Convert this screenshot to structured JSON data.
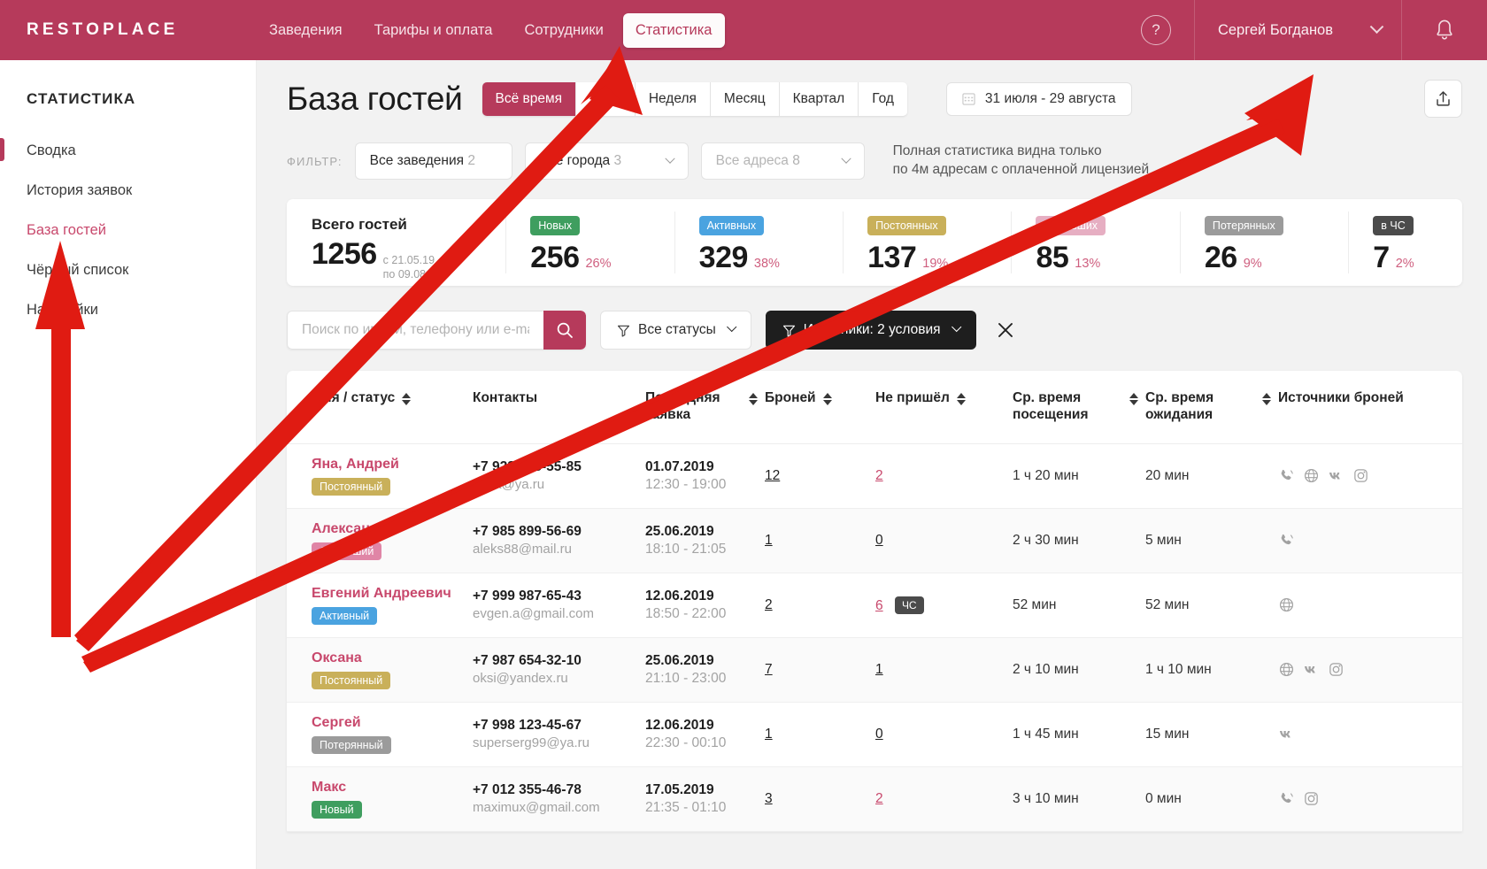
{
  "brand": "RESTOPLACE",
  "topnav": {
    "items": [
      {
        "label": "Заведения",
        "active": false
      },
      {
        "label": "Тарифы и оплата",
        "active": false
      },
      {
        "label": "Сотрудники",
        "active": false
      },
      {
        "label": "Статистика",
        "active": true
      }
    ],
    "help_icon": "question-mark-icon",
    "help_label": "?",
    "user": "Сергей Богданов",
    "bell_icon": "bell-icon"
  },
  "sidebar": {
    "title": "СТАТИСТИКА",
    "items": [
      {
        "label": "Сводка",
        "active": false
      },
      {
        "label": "История заявок",
        "active": false
      },
      {
        "label": "База гостей",
        "active": true
      },
      {
        "label": "Чёрный список",
        "active": false
      },
      {
        "label": "Настройки",
        "active": false
      }
    ]
  },
  "page": {
    "title": "База гостей",
    "periods": [
      {
        "label": "Всё время",
        "active": true
      },
      {
        "label": "День",
        "active": false
      },
      {
        "label": "Неделя",
        "active": false
      },
      {
        "label": "Месяц",
        "active": false
      },
      {
        "label": "Квартал",
        "active": false
      },
      {
        "label": "Год",
        "active": false
      }
    ],
    "daterange": "31 июля - 29 августа",
    "calendar_icon": "calendar-icon",
    "export_icon": "share-export-icon"
  },
  "filters": {
    "label": "ФИЛЬТР:",
    "venues": {
      "text": "Все заведения",
      "count": "2"
    },
    "cities": {
      "text": "Все города",
      "count": "3"
    },
    "addresses": {
      "text": "Все адреса",
      "count": "8"
    },
    "license_note_line1": "Полная статистика видна только",
    "license_note_line2": "по 4м адресам с оплаченной лицензией"
  },
  "stats": {
    "total": {
      "title": "Всего гостей",
      "value": "1256",
      "sub_line1": "с 21.05.19",
      "sub_line2": "по 09.08.19"
    },
    "cards": [
      {
        "badge": "Новых",
        "badge_color": "#3f9e5f",
        "badge_text_color": "#ffffff",
        "value": "256",
        "pct": "26%"
      },
      {
        "badge": "Активных",
        "badge_color": "#4aa3e0",
        "badge_text_color": "#ffffff",
        "value": "329",
        "pct": "38%"
      },
      {
        "badge": "Постоянных",
        "badge_color": "#c9b05a",
        "badge_text_color": "#ffffff",
        "value": "137",
        "pct": "19%"
      },
      {
        "badge": "Остывших",
        "badge_color": "#e6aec2",
        "badge_text_color": "#ffffff",
        "value": "85",
        "pct": "13%"
      },
      {
        "badge": "Потерянных",
        "badge_color": "#9b9b9b",
        "badge_text_color": "#ffffff",
        "value": "26",
        "pct": "9%"
      },
      {
        "badge": "в ЧС",
        "badge_color": "#4b4b4b",
        "badge_text_color": "#ffffff",
        "value": "7",
        "pct": "2%"
      }
    ]
  },
  "search": {
    "placeholder": "Поиск по имени, телефону или e-mail",
    "value": "",
    "search_icon": "search-icon",
    "status_chip": "Все статусы",
    "sources_chip": "Источники: 2 условия",
    "filter_icon": "funnel-icon",
    "clear_icon": "close-x-icon"
  },
  "table": {
    "columns": [
      {
        "label": "Имя / статус",
        "sortable": true
      },
      {
        "label": "Контакты",
        "sortable": false
      },
      {
        "label": "Последняя заявка",
        "sortable": true
      },
      {
        "label": "Броней",
        "sortable": true
      },
      {
        "label": "Не пришёл",
        "sortable": true
      },
      {
        "label": "Ср. время посещения",
        "sortable": true
      },
      {
        "label": "Ср. время ожидания",
        "sortable": true
      },
      {
        "label": "Источники броней",
        "sortable": false
      }
    ],
    "rows": [
      {
        "name": "Яна, Андрей",
        "status": "Постоянный",
        "status_color": "#c9b05a",
        "phone": "+7 928 565-55-85",
        "email": "yana@ya.ru",
        "date": "01.07.2019",
        "time": "12:30 - 19:00",
        "bookings": "12",
        "noshow": "2",
        "noshow_flag": "",
        "avg_visit": "1 ч 20 мин",
        "avg_wait": "20 мин",
        "sources": [
          "phone-icon",
          "globe-icon",
          "vk-icon",
          "instagram-icon"
        ]
      },
      {
        "name": "Александр",
        "status": "Остывший",
        "status_color": "#e085a6",
        "phone": "+7 985 899-56-69",
        "email": "aleks88@mail.ru",
        "date": "25.06.2019",
        "time": "18:10 - 21:05",
        "bookings": "1",
        "noshow": "0",
        "noshow_flag": "",
        "avg_visit": "2 ч 30 мин",
        "avg_wait": "5 мин",
        "sources": [
          "phone-icon"
        ]
      },
      {
        "name": "Евгений Андреевич",
        "status": "Активный",
        "status_color": "#4aa3e0",
        "phone": "+7 999 987-65-43",
        "email": "evgen.a@gmail.com",
        "date": "12.06.2019",
        "time": "18:50 - 22:00",
        "bookings": "2",
        "noshow": "6",
        "noshow_flag": "ЧС",
        "avg_visit": "52 мин",
        "avg_wait": "52 мин",
        "sources": [
          "globe-icon"
        ]
      },
      {
        "name": "Оксана",
        "status": "Постоянный",
        "status_color": "#c9b05a",
        "phone": "+7 987 654-32-10",
        "email": "oksi@yandex.ru",
        "date": "25.06.2019",
        "time": "21:10 - 23:00",
        "bookings": "7",
        "noshow": "1",
        "noshow_flag": "",
        "avg_visit": "2 ч 10 мин",
        "avg_wait": "1 ч 10 мин",
        "sources": [
          "globe-icon",
          "vk-icon",
          "instagram-icon"
        ]
      },
      {
        "name": "Сергей",
        "status": "Потерянный",
        "status_color": "#9b9b9b",
        "phone": "+7 998 123-45-67",
        "email": "superserg99@ya.ru",
        "date": "12.06.2019",
        "time": "22:30 - 00:10",
        "bookings": "1",
        "noshow": "0",
        "noshow_flag": "",
        "avg_visit": "1 ч 45 мин",
        "avg_wait": "15 мин",
        "sources": [
          "vk-icon"
        ]
      },
      {
        "name": "Макс",
        "status": "Новый",
        "status_color": "#3f9e5f",
        "phone": "+7 012 355-46-78",
        "email": "maximux@gmail.com",
        "date": "17.05.2019",
        "time": "21:35 - 01:10",
        "bookings": "3",
        "noshow": "2",
        "noshow_flag": "",
        "avg_visit": "3 ч 10 мин",
        "avg_wait": "0 мин",
        "sources": [
          "phone-icon",
          "instagram-icon"
        ]
      }
    ]
  },
  "annotations": {
    "color": "#e01b12",
    "arrow_targets": [
      "Статистика",
      "База гостей",
      "export-button"
    ]
  }
}
